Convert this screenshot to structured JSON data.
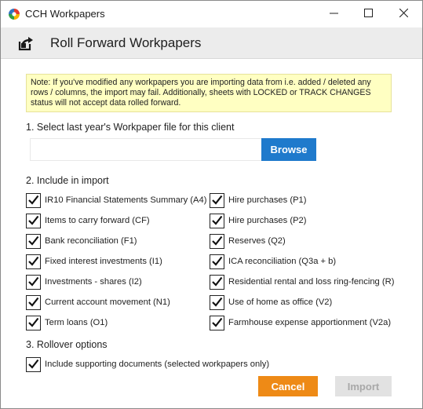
{
  "window": {
    "title": "CCH Workpapers",
    "logo_icon": "cch-logo-icon",
    "controls": [
      "minimize-icon",
      "maximize-icon",
      "close-icon"
    ]
  },
  "header": {
    "title": "Roll Forward Workpapers",
    "icon": "roll-forward-icon"
  },
  "note": {
    "text": "Note: If you've modified any workpapers you are importing data from i.e. added / deleted any rows / columns, the import may fail. Additionally, sheets with LOCKED or TRACK CHANGES status will not accept data rolled forward.",
    "background": "#ffffc2"
  },
  "section1": {
    "label": "1. Select last year's Workpaper file for this client",
    "file_value": "",
    "browse_label": "Browse",
    "browse_color": "#1f7acc"
  },
  "section2": {
    "label": "2. Include in import",
    "left_items": [
      {
        "label": "IR10 Financial Statements Summary (A4)",
        "checked": true
      },
      {
        "label": "Items to carry forward (CF)",
        "checked": true
      },
      {
        "label": "Bank reconciliation (F1)",
        "checked": true
      },
      {
        "label": "Fixed interest investments (I1)",
        "checked": true
      },
      {
        "label": "Investments - shares (I2)",
        "checked": true
      },
      {
        "label": "Current account movement (N1)",
        "checked": true
      },
      {
        "label": "Term loans (O1)",
        "checked": true
      }
    ],
    "right_items": [
      {
        "label": "Hire purchases (P1)",
        "checked": true
      },
      {
        "label": "Hire purchases (P2)",
        "checked": true
      },
      {
        "label": "Reserves (Q2)",
        "checked": true
      },
      {
        "label": "ICA reconciliation (Q3a + b)",
        "checked": true
      },
      {
        "label": "Residential rental and loss ring-fencing (R)",
        "checked": true
      },
      {
        "label": "Use of home as office (V2)",
        "checked": true
      },
      {
        "label": "Farmhouse expense apportionment (V2a)",
        "checked": true
      }
    ]
  },
  "section3": {
    "label": "3. Rollover options",
    "items": [
      {
        "label": "Include supporting documents (selected workpapers only)",
        "checked": true
      }
    ]
  },
  "actions": {
    "cancel_label": "Cancel",
    "cancel_color": "#ee8a16",
    "import_label": "Import",
    "import_enabled": false
  }
}
